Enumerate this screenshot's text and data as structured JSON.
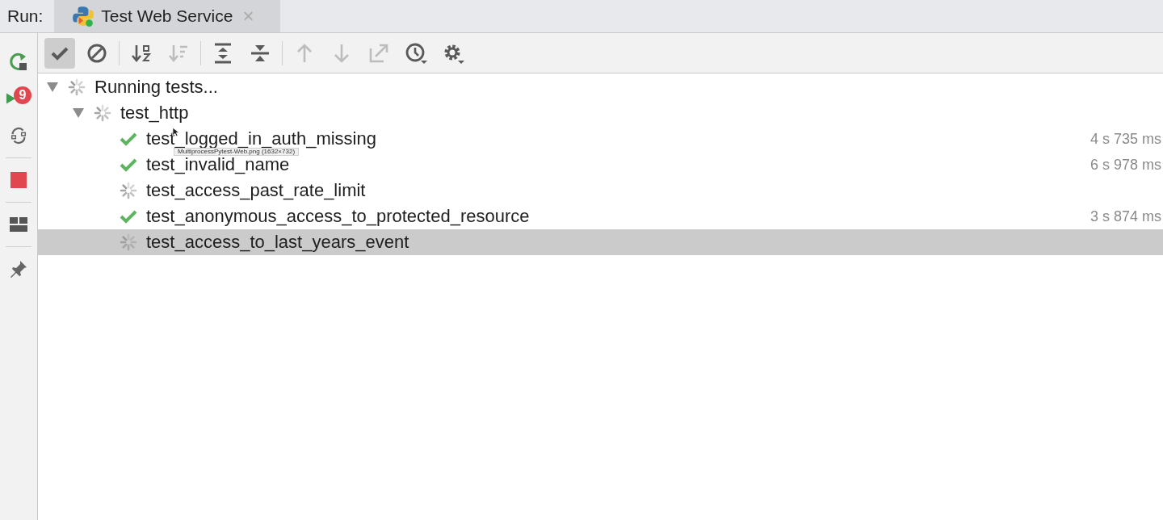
{
  "run_label": "Run:",
  "tabs": [
    {
      "title": "Test Web Service",
      "selected": true,
      "close": "×"
    }
  ],
  "side_buttons": [
    {
      "kind": "rerun"
    },
    {
      "kind": "rerun_failed",
      "badge": "9"
    },
    {
      "kind": "auto_test"
    },
    {
      "kind": "stop"
    },
    {
      "kind": "layout"
    },
    {
      "kind": "pin"
    }
  ],
  "toolbar": [
    {
      "kind": "passed",
      "selected": true,
      "disabled": false
    },
    {
      "kind": "ignored",
      "selected": false,
      "disabled": false
    },
    {
      "kind": "sort_alpha",
      "selected": false,
      "disabled": false
    },
    {
      "kind": "sort_duration",
      "selected": false,
      "disabled": true
    },
    {
      "kind": "expand",
      "selected": false,
      "disabled": false
    },
    {
      "kind": "collapse",
      "selected": false,
      "disabled": false
    },
    {
      "kind": "up",
      "selected": false,
      "disabled": true
    },
    {
      "kind": "down",
      "selected": false,
      "disabled": true
    },
    {
      "kind": "export",
      "selected": false,
      "disabled": true
    },
    {
      "kind": "history",
      "selected": false,
      "disabled": false
    },
    {
      "kind": "settings",
      "selected": false,
      "disabled": false
    }
  ],
  "tree": [
    {
      "label": "Running tests...",
      "passed": false,
      "expanded": true,
      "selected": false,
      "children": [
        {
          "label": "test_http",
          "passed": false,
          "expanded": true,
          "selected": false,
          "children": [
            {
              "label": "test_logged_in_auth_missing",
              "passed": true,
              "selected": false,
              "duration": "4 s 735 ms"
            },
            {
              "label": "test_invalid_name",
              "passed": true,
              "selected": false,
              "duration": "6 s 978 ms"
            },
            {
              "label": "test_access_past_rate_limit",
              "passed": false,
              "selected": false
            },
            {
              "label": "test_anonymous_access_to_protected_resource",
              "passed": true,
              "selected": false,
              "duration": "3 s 874 ms"
            },
            {
              "label": "test_access_to_last_years_event",
              "passed": false,
              "selected": true
            }
          ]
        }
      ]
    }
  ],
  "tooltip": "MultiprocessPytest-Web.png (1632×732)"
}
